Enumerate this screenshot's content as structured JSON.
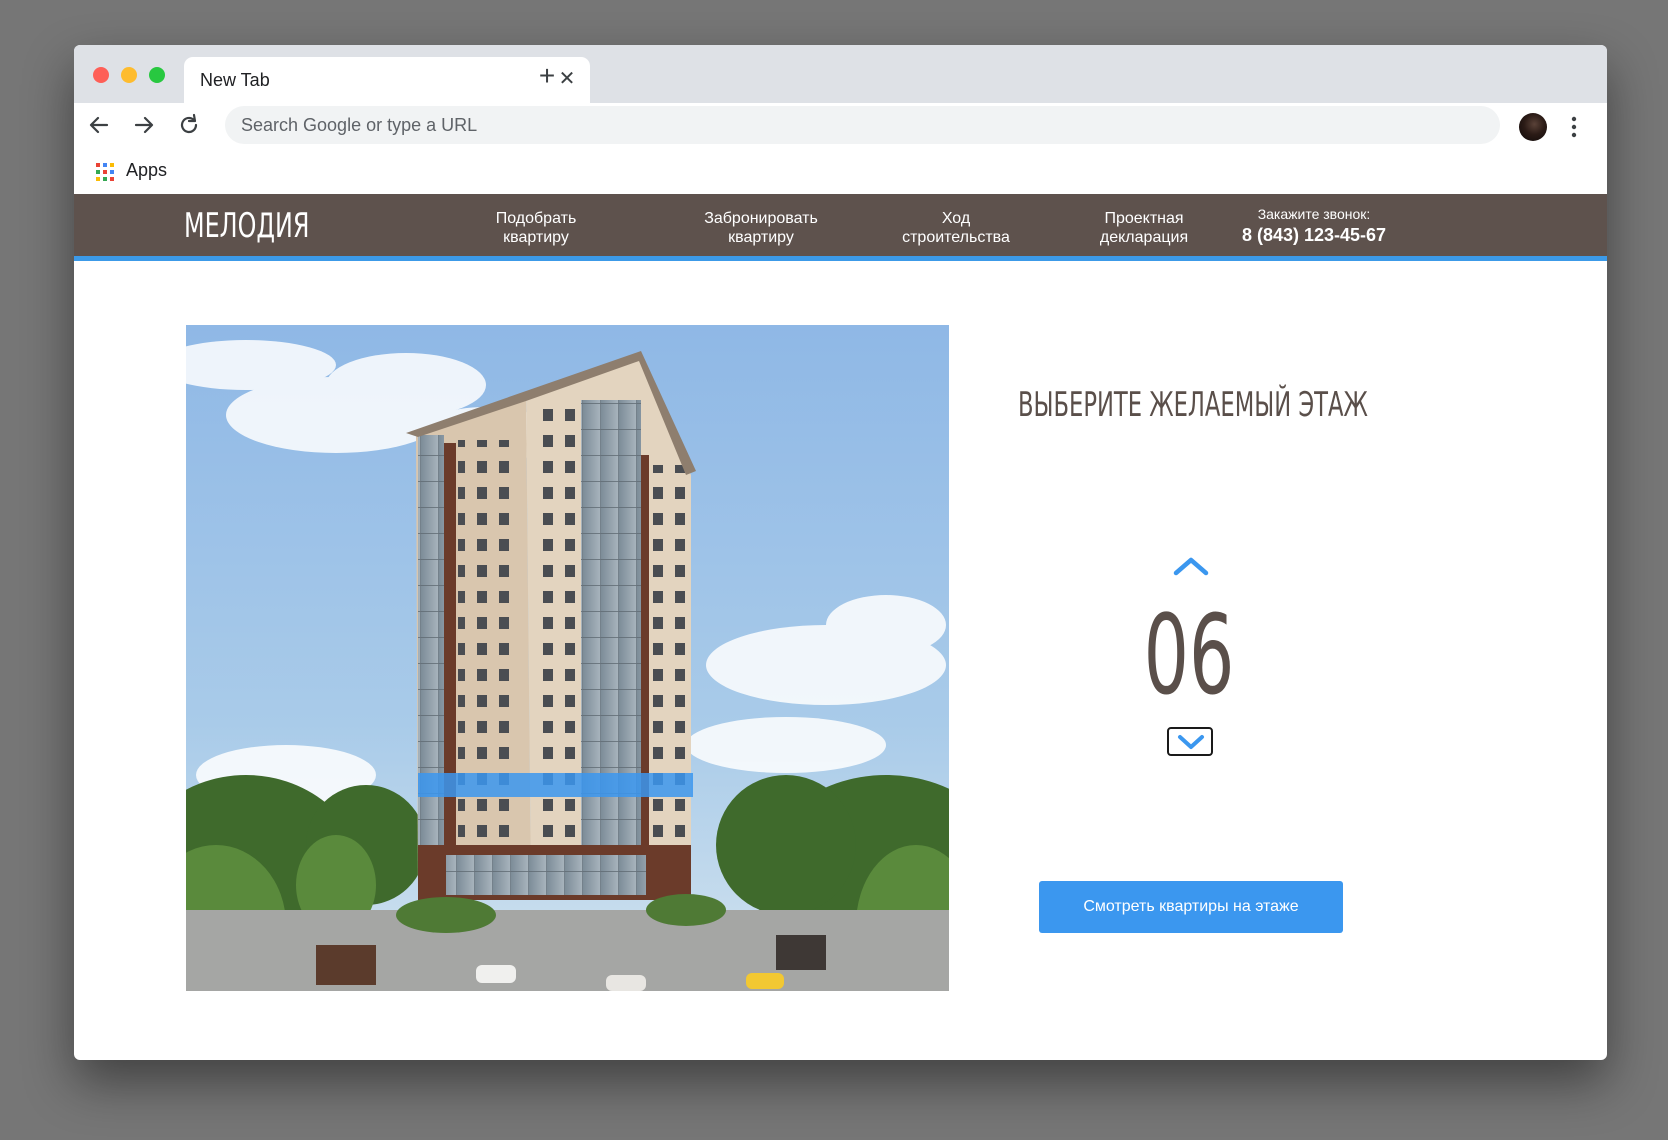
{
  "browser": {
    "tab_title": "New Tab",
    "omnibox_placeholder": "Search Google or type a URL",
    "bookmarks": [
      {
        "label": "Apps"
      }
    ]
  },
  "site": {
    "logo": "МЕЛОДИЯ",
    "nav": [
      {
        "label_line1": "Подобрать",
        "label_line2": "квартиру"
      },
      {
        "label_line1": "Забронировать",
        "label_line2": "квартиру"
      },
      {
        "label_line1": "Ход",
        "label_line2": "строительства"
      },
      {
        "label_line1": "Проектная",
        "label_line2": "декларация"
      }
    ],
    "callback": {
      "caption": "Закажите звонок:",
      "phone": "8 (843) 123-45-67"
    }
  },
  "floor_picker": {
    "heading": "ВЫБЕРИТЕ ЖЕЛАЕМЫЙ ЭТАЖ",
    "current_floor": "06",
    "cta_label": "Смотреть квартиры на этаже"
  },
  "colors": {
    "header_bg": "#5e524d",
    "accent": "#3b97ef",
    "text_dark": "#5a4f4a"
  },
  "icons": [
    "back-arrow-icon",
    "forward-arrow-icon",
    "reload-icon",
    "apps-grid-icon",
    "more-vert-icon",
    "chevron-up-icon",
    "chevron-down-icon",
    "close-icon",
    "plus-icon"
  ]
}
